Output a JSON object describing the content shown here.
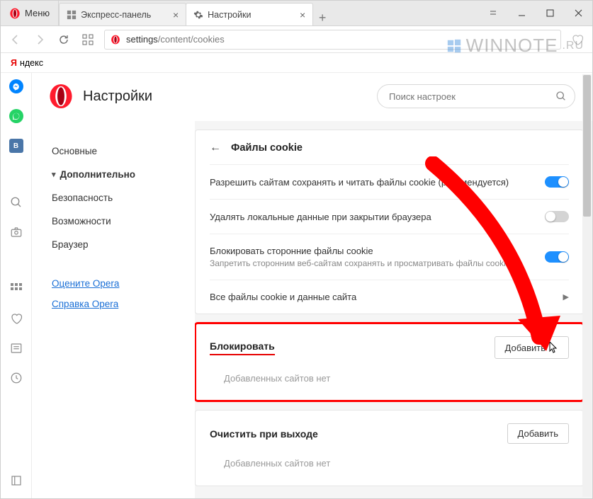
{
  "titlebar": {
    "menu": "Меню",
    "tabs": [
      {
        "icon": "speed-dial-icon",
        "label": "Экспресс-панель",
        "active": false
      },
      {
        "icon": "gear-icon",
        "label": "Настройки",
        "active": true
      }
    ]
  },
  "addressbar": {
    "url_prefix": "settings",
    "url_rest": "/content/cookies"
  },
  "yandex": {
    "letter": "Я",
    "text": "ндекс"
  },
  "page": {
    "title": "Настройки",
    "search_placeholder": "Поиск настроек"
  },
  "sidenav": {
    "items": [
      {
        "label": "Основные",
        "type": "item"
      },
      {
        "label": "Дополнительно",
        "type": "expanded"
      },
      {
        "label": "Безопасность",
        "type": "sub"
      },
      {
        "label": "Возможности",
        "type": "sub"
      },
      {
        "label": "Браузер",
        "type": "sub"
      }
    ],
    "links": [
      {
        "label": "Оцените Opera"
      },
      {
        "label": "Справка Opera"
      }
    ]
  },
  "panel": {
    "title": "Файлы cookie",
    "options": [
      {
        "label": "Разрешить сайтам сохранять и читать файлы cookie (рекомендуется)",
        "sub": "",
        "on": true
      },
      {
        "label": "Удалять локальные данные при закрытии браузера",
        "sub": "",
        "on": false
      },
      {
        "label": "Блокировать сторонние файлы cookie",
        "sub": "Запретить сторонним веб-сайтам сохранять и просматривать файлы cookie",
        "on": true
      }
    ],
    "row_link": "Все файлы cookie и данные сайта"
  },
  "sections": [
    {
      "title": "Блокировать",
      "button": "Добавить",
      "empty": "Добавленных сайтов нет",
      "highlight": true
    },
    {
      "title": "Очистить при выходе",
      "button": "Добавить",
      "empty": "Добавленных сайтов нет",
      "highlight": false
    }
  ],
  "watermark": {
    "text1": "WINNOTE",
    "text2": ".RU"
  }
}
